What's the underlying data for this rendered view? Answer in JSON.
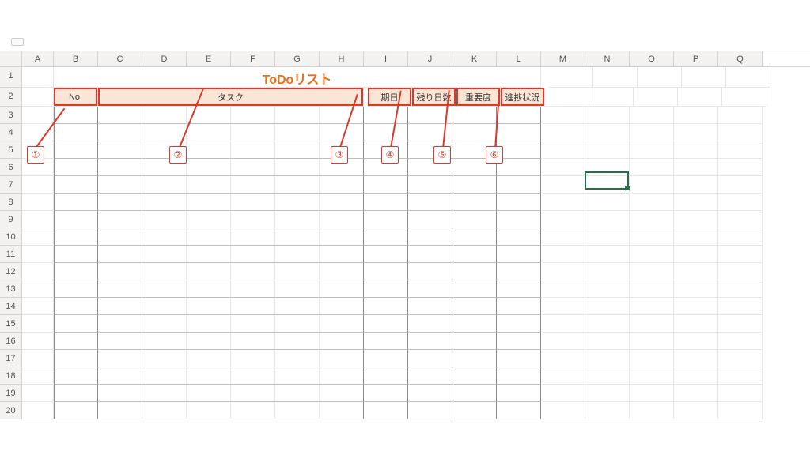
{
  "columns": [
    "A",
    "B",
    "C",
    "D",
    "E",
    "F",
    "G",
    "H",
    "I",
    "J",
    "K",
    "L",
    "M",
    "N",
    "O",
    "P",
    "Q"
  ],
  "row_count": 20,
  "title": "ToDoリスト",
  "headers": {
    "no": "No.",
    "task": "タスク",
    "due": "期日",
    "days_left": "残り日数",
    "importance": "重要度",
    "progress": "進捗状況"
  },
  "annotations": {
    "1": "①",
    "2": "②",
    "3": "③",
    "4": "④",
    "5": "⑤",
    "6": "⑥"
  },
  "active_cell": "M7"
}
